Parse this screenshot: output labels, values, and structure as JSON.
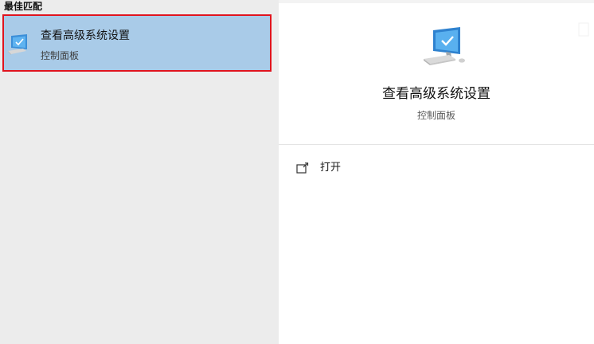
{
  "results": {
    "section_heading": "最佳匹配",
    "best_match": {
      "title": "查看高级系统设置",
      "subtitle": "控制面板",
      "icon": "computer-settings-icon"
    }
  },
  "detail": {
    "title": "查看高级系统设置",
    "subtitle": "控制面板",
    "icon": "computer-settings-icon",
    "actions": [
      {
        "label": "打开",
        "icon": "open-icon"
      }
    ]
  },
  "colors": {
    "left_pane_bg": "#ececec",
    "selected_bg": "#a9cbe8",
    "selection_outline": "#e0141e",
    "right_pane_bg": "#ffffff",
    "icon_blue": "#2f8fe0"
  }
}
